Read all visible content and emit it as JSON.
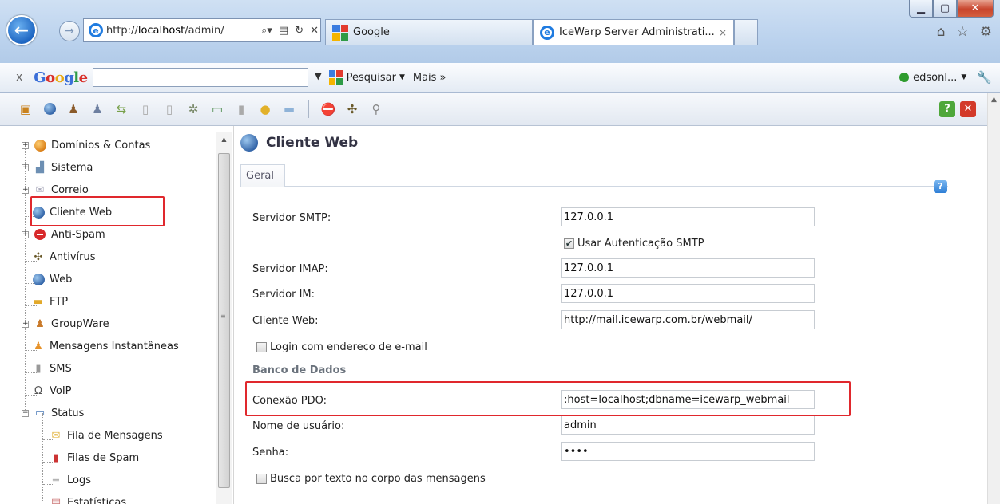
{
  "browser": {
    "address": {
      "prefix": "http://",
      "host": "localhost",
      "rest": "/admin/"
    },
    "tabs": [
      {
        "label": "Google"
      },
      {
        "label": "IceWarp Server Administrati...",
        "close": "×"
      }
    ]
  },
  "google_toolbar": {
    "close": "x",
    "logo": "Google",
    "search_value": "",
    "search_label": "Pesquisar",
    "more_label": "Mais »",
    "user_label": "edsonl..."
  },
  "tree": {
    "items": [
      {
        "label": "Domínios & Contas"
      },
      {
        "label": "Sistema"
      },
      {
        "label": "Correio"
      },
      {
        "label": "Cliente Web"
      },
      {
        "label": "Anti-Spam"
      },
      {
        "label": "Antivírus"
      },
      {
        "label": "Web"
      },
      {
        "label": "FTP"
      },
      {
        "label": "GroupWare"
      },
      {
        "label": "Mensagens Instantâneas"
      },
      {
        "label": "SMS"
      },
      {
        "label": "VoIP"
      },
      {
        "label": "Status"
      },
      {
        "label": "Fila de Mensagens"
      },
      {
        "label": "Filas de Spam"
      },
      {
        "label": "Logs"
      },
      {
        "label": "Estatísticas"
      }
    ]
  },
  "page": {
    "title": "Cliente Web",
    "tab": "Geral",
    "help": "?",
    "fields": {
      "smtp_label": "Servidor SMTP:",
      "smtp_value": "127.0.0.1",
      "smtp_auth_label": "Usar Autenticação SMTP",
      "imap_label": "Servidor IMAP:",
      "imap_value": "127.0.0.1",
      "im_label": "Servidor IM:",
      "im_value": "127.0.0.1",
      "webclient_label": "Cliente Web:",
      "webclient_value": "http://mail.icewarp.com.br/webmail/",
      "login_email_label": "Login com endereço de e-mail",
      "db_section": "Banco de Dados",
      "pdo_label": "Conexão PDO:",
      "pdo_value": ":host=localhost;dbname=icewarp_webmail",
      "user_label": "Nome de usuário:",
      "user_value": "admin",
      "pass_label": "Senha:",
      "pass_value": "••••",
      "fulltext_label": "Busca por texto no corpo das mensagens"
    }
  },
  "colors": {
    "highlight": "#e0282d",
    "accent": "#1e66c2"
  }
}
